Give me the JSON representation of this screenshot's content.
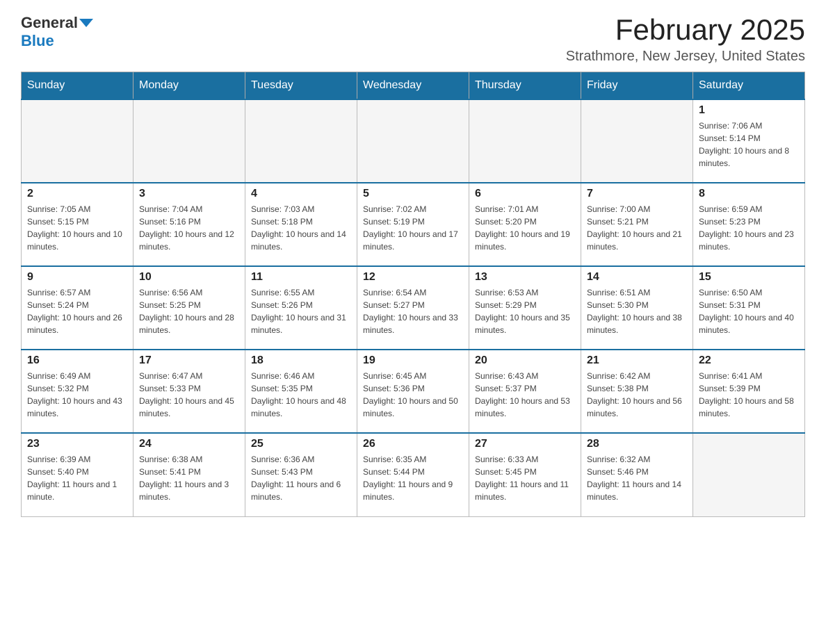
{
  "logo": {
    "general": "General",
    "blue": "Blue"
  },
  "title": "February 2025",
  "location": "Strathmore, New Jersey, United States",
  "days_of_week": [
    "Sunday",
    "Monday",
    "Tuesday",
    "Wednesday",
    "Thursday",
    "Friday",
    "Saturday"
  ],
  "weeks": [
    [
      {
        "day": "",
        "info": ""
      },
      {
        "day": "",
        "info": ""
      },
      {
        "day": "",
        "info": ""
      },
      {
        "day": "",
        "info": ""
      },
      {
        "day": "",
        "info": ""
      },
      {
        "day": "",
        "info": ""
      },
      {
        "day": "1",
        "info": "Sunrise: 7:06 AM\nSunset: 5:14 PM\nDaylight: 10 hours and 8 minutes."
      }
    ],
    [
      {
        "day": "2",
        "info": "Sunrise: 7:05 AM\nSunset: 5:15 PM\nDaylight: 10 hours and 10 minutes."
      },
      {
        "day": "3",
        "info": "Sunrise: 7:04 AM\nSunset: 5:16 PM\nDaylight: 10 hours and 12 minutes."
      },
      {
        "day": "4",
        "info": "Sunrise: 7:03 AM\nSunset: 5:18 PM\nDaylight: 10 hours and 14 minutes."
      },
      {
        "day": "5",
        "info": "Sunrise: 7:02 AM\nSunset: 5:19 PM\nDaylight: 10 hours and 17 minutes."
      },
      {
        "day": "6",
        "info": "Sunrise: 7:01 AM\nSunset: 5:20 PM\nDaylight: 10 hours and 19 minutes."
      },
      {
        "day": "7",
        "info": "Sunrise: 7:00 AM\nSunset: 5:21 PM\nDaylight: 10 hours and 21 minutes."
      },
      {
        "day": "8",
        "info": "Sunrise: 6:59 AM\nSunset: 5:23 PM\nDaylight: 10 hours and 23 minutes."
      }
    ],
    [
      {
        "day": "9",
        "info": "Sunrise: 6:57 AM\nSunset: 5:24 PM\nDaylight: 10 hours and 26 minutes."
      },
      {
        "day": "10",
        "info": "Sunrise: 6:56 AM\nSunset: 5:25 PM\nDaylight: 10 hours and 28 minutes."
      },
      {
        "day": "11",
        "info": "Sunrise: 6:55 AM\nSunset: 5:26 PM\nDaylight: 10 hours and 31 minutes."
      },
      {
        "day": "12",
        "info": "Sunrise: 6:54 AM\nSunset: 5:27 PM\nDaylight: 10 hours and 33 minutes."
      },
      {
        "day": "13",
        "info": "Sunrise: 6:53 AM\nSunset: 5:29 PM\nDaylight: 10 hours and 35 minutes."
      },
      {
        "day": "14",
        "info": "Sunrise: 6:51 AM\nSunset: 5:30 PM\nDaylight: 10 hours and 38 minutes."
      },
      {
        "day": "15",
        "info": "Sunrise: 6:50 AM\nSunset: 5:31 PM\nDaylight: 10 hours and 40 minutes."
      }
    ],
    [
      {
        "day": "16",
        "info": "Sunrise: 6:49 AM\nSunset: 5:32 PM\nDaylight: 10 hours and 43 minutes."
      },
      {
        "day": "17",
        "info": "Sunrise: 6:47 AM\nSunset: 5:33 PM\nDaylight: 10 hours and 45 minutes."
      },
      {
        "day": "18",
        "info": "Sunrise: 6:46 AM\nSunset: 5:35 PM\nDaylight: 10 hours and 48 minutes."
      },
      {
        "day": "19",
        "info": "Sunrise: 6:45 AM\nSunset: 5:36 PM\nDaylight: 10 hours and 50 minutes."
      },
      {
        "day": "20",
        "info": "Sunrise: 6:43 AM\nSunset: 5:37 PM\nDaylight: 10 hours and 53 minutes."
      },
      {
        "day": "21",
        "info": "Sunrise: 6:42 AM\nSunset: 5:38 PM\nDaylight: 10 hours and 56 minutes."
      },
      {
        "day": "22",
        "info": "Sunrise: 6:41 AM\nSunset: 5:39 PM\nDaylight: 10 hours and 58 minutes."
      }
    ],
    [
      {
        "day": "23",
        "info": "Sunrise: 6:39 AM\nSunset: 5:40 PM\nDaylight: 11 hours and 1 minute."
      },
      {
        "day": "24",
        "info": "Sunrise: 6:38 AM\nSunset: 5:41 PM\nDaylight: 11 hours and 3 minutes."
      },
      {
        "day": "25",
        "info": "Sunrise: 6:36 AM\nSunset: 5:43 PM\nDaylight: 11 hours and 6 minutes."
      },
      {
        "day": "26",
        "info": "Sunrise: 6:35 AM\nSunset: 5:44 PM\nDaylight: 11 hours and 9 minutes."
      },
      {
        "day": "27",
        "info": "Sunrise: 6:33 AM\nSunset: 5:45 PM\nDaylight: 11 hours and 11 minutes."
      },
      {
        "day": "28",
        "info": "Sunrise: 6:32 AM\nSunset: 5:46 PM\nDaylight: 11 hours and 14 minutes."
      },
      {
        "day": "",
        "info": ""
      }
    ]
  ]
}
